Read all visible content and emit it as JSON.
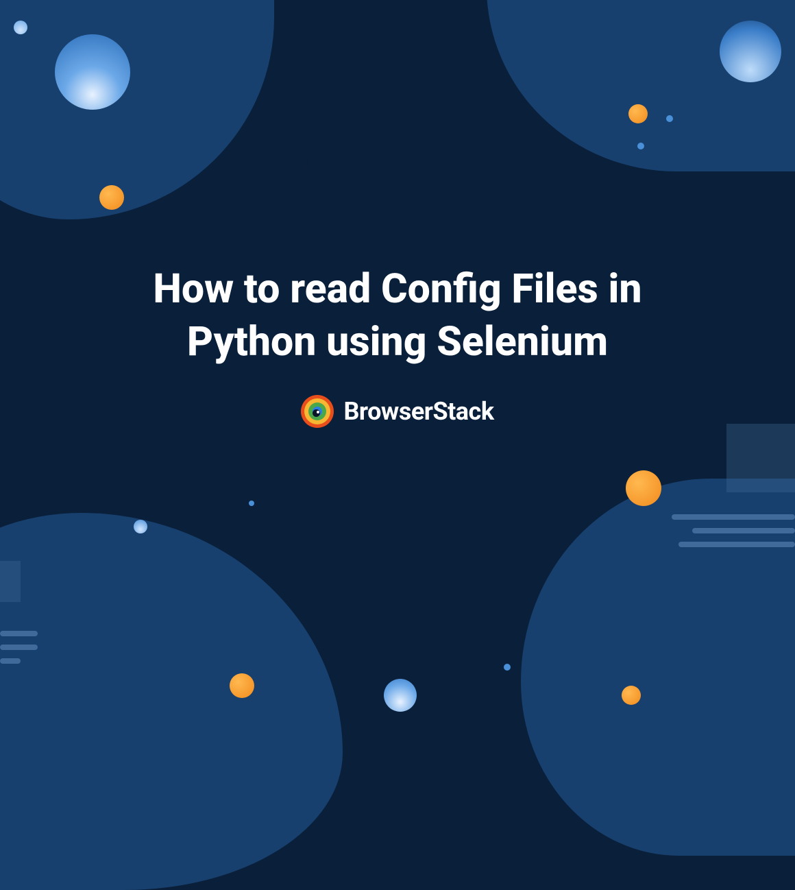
{
  "title": "How to read Config Files in Python using Selenium",
  "brand": "BrowserStack"
}
